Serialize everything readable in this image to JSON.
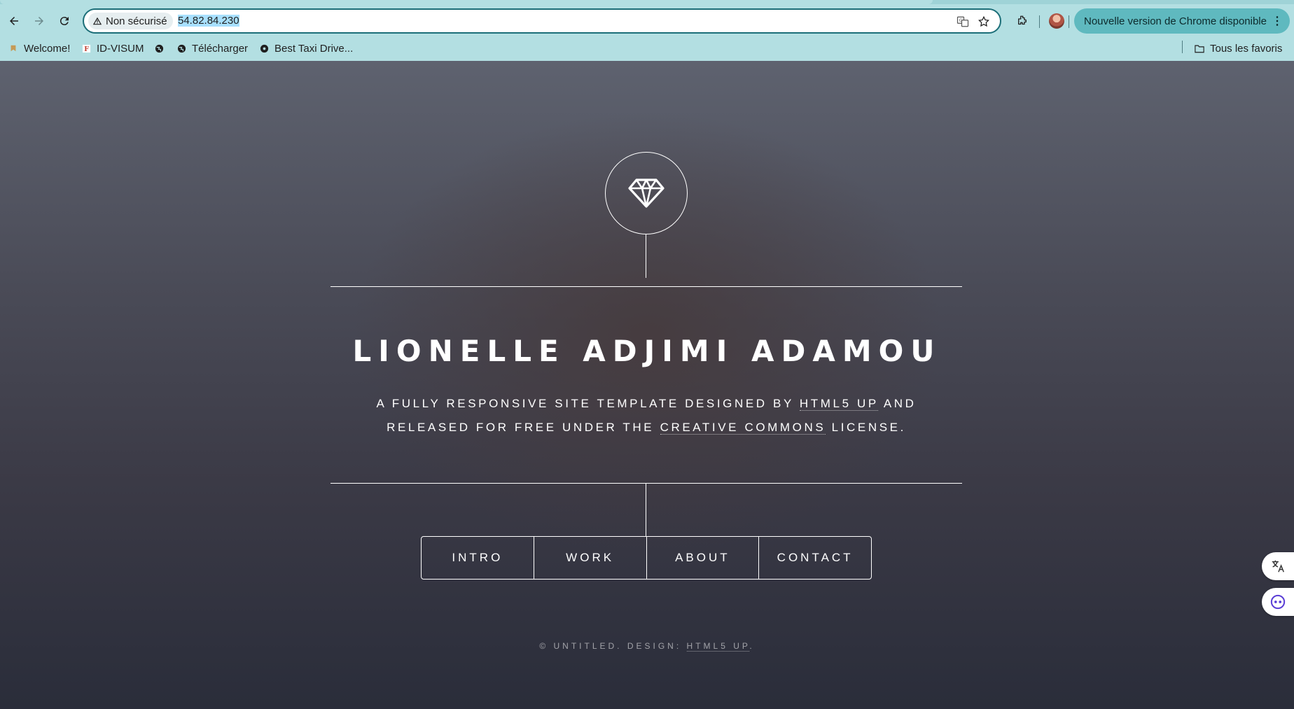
{
  "browser": {
    "security_label": "Non sécurisé",
    "url": "54.82.84.230",
    "update_label": "Nouvelle version de Chrome disponible",
    "update_menu_glyph": "⋮"
  },
  "bookmarks": {
    "items": [
      {
        "label": "Welcome!",
        "icon": "bookmark-icon"
      },
      {
        "label": "ID-VISUM",
        "icon": "favicon-f-icon"
      },
      {
        "label": "",
        "icon": "globe-icon"
      },
      {
        "label": "Télécharger",
        "icon": "globe-icon"
      },
      {
        "label": "Best Taxi Drive...",
        "icon": "favicon-dark-icon"
      }
    ],
    "all_bookmarks_label": "Tous les favoris"
  },
  "site": {
    "title": "LIONELLE ADJIMI ADAMOU",
    "tagline_part1": "A FULLY RESPONSIVE SITE TEMPLATE DESIGNED BY ",
    "tagline_link1": "HTML5 UP",
    "tagline_part2": " AND RELEASED FOR FREE UNDER THE ",
    "tagline_link2": "CREATIVE COMMONS",
    "tagline_part3": " LICENSE.",
    "nav": [
      "INTRO",
      "WORK",
      "ABOUT",
      "CONTACT"
    ],
    "footer_text": "© UNTITLED. DESIGN: ",
    "footer_link": "HTML5 UP",
    "footer_end": "."
  },
  "colors": {
    "chrome_bg": "#b3dfe2",
    "update_button": "#5fb9bf",
    "page_top": "#5e626f",
    "page_bottom": "#2a2d3a"
  }
}
